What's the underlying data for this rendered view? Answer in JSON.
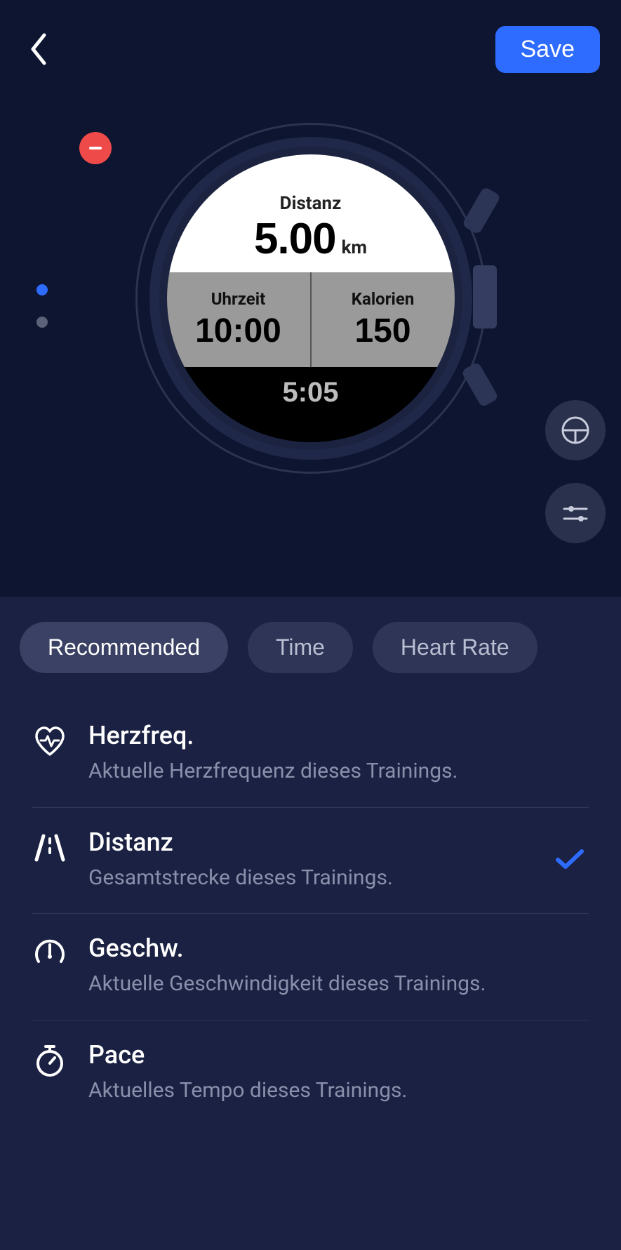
{
  "header": {
    "save_label": "Save"
  },
  "watch": {
    "top": {
      "label": "Distanz",
      "value": "5.00",
      "unit": "km"
    },
    "mid_left": {
      "label": "Uhrzeit",
      "value": "10:00"
    },
    "mid_right": {
      "label": "Kalorien",
      "value": "150"
    },
    "bottom": {
      "value": "5:05"
    }
  },
  "tabs": [
    {
      "label": "Recommended",
      "active": true
    },
    {
      "label": "Time",
      "active": false
    },
    {
      "label": "Heart Rate",
      "active": false
    }
  ],
  "items": [
    {
      "icon": "heart",
      "title": "Herzfreq.",
      "desc": "Aktuelle Herzfrequenz dieses Trainings.",
      "selected": false
    },
    {
      "icon": "road",
      "title": "Distanz",
      "desc": "Gesamtstrecke dieses Trainings.",
      "selected": true
    },
    {
      "icon": "gauge",
      "title": "Geschw.",
      "desc": "Aktuelle Geschwindigkeit dieses Trainings.",
      "selected": false
    },
    {
      "icon": "stopwatch",
      "title": "Pace",
      "desc": "Aktuelles Tempo dieses Trainings.",
      "selected": false
    }
  ]
}
